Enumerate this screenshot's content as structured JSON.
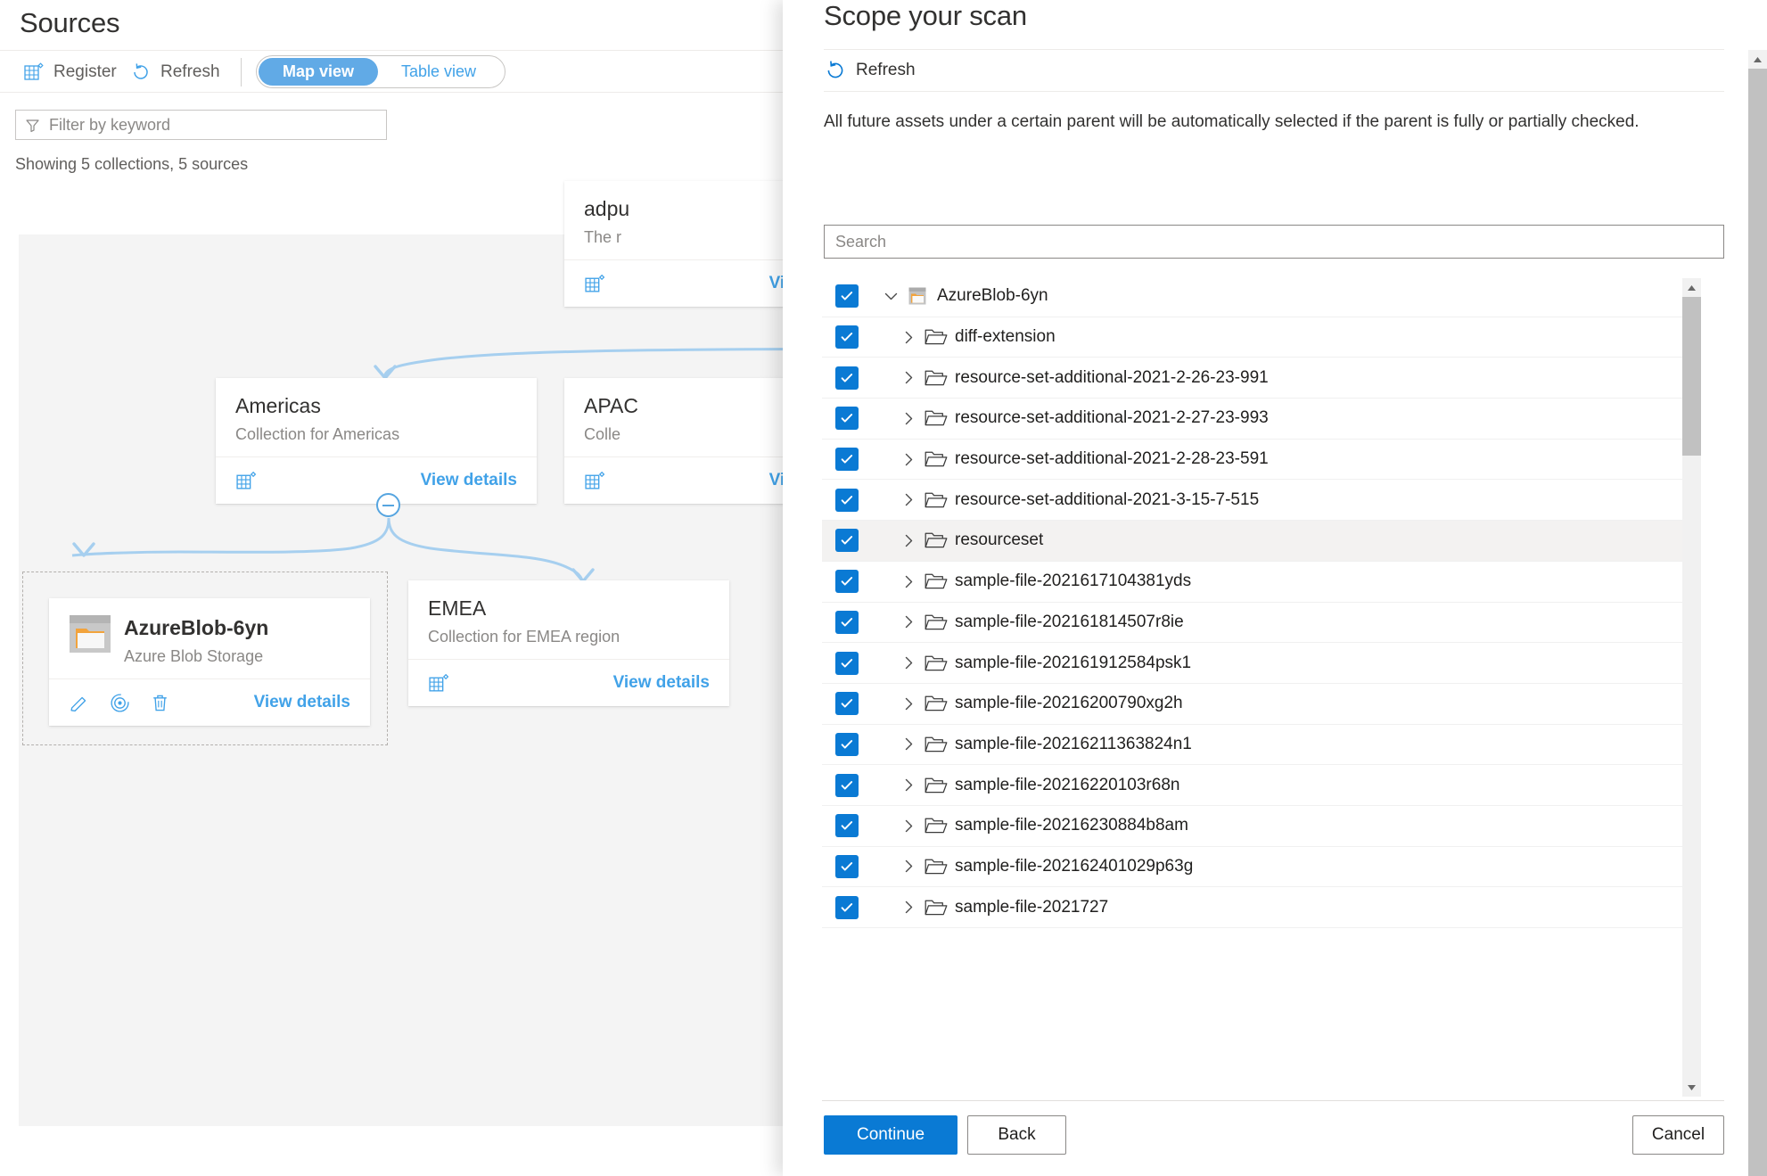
{
  "sources": {
    "title": "Sources",
    "commands": [
      {
        "label": "Register",
        "icon": "register-grid-icon"
      },
      {
        "label": "Refresh",
        "icon": "refresh-icon"
      }
    ],
    "view_toggle": {
      "active": "Map view",
      "inactive": "Table view"
    },
    "filter": {
      "placeholder": "Filter by keyword",
      "value": "",
      "icon": "filter-funnel-icon"
    },
    "status": "Showing 5 collections, 5 sources",
    "cards": [
      {
        "id": "adpurv",
        "title": "adpu",
        "subtitle": "The r",
        "footer_icon": "collection-grid-icon",
        "view_details": "View details",
        "clipped": true
      },
      {
        "id": "americas",
        "title": "Americas",
        "subtitle": "Collection for Americas",
        "footer_icon": "collection-grid-icon",
        "view_details": "View details",
        "clipped": false
      },
      {
        "id": "apac",
        "title": "APAC",
        "subtitle": "Colle",
        "footer_icon": "collection-grid-icon",
        "view_details": "View details",
        "clipped": true
      },
      {
        "id": "emea",
        "title": "EMEA",
        "subtitle": "Collection for EMEA region",
        "footer_icon": "collection-grid-icon",
        "view_details": "View details",
        "clipped": true
      }
    ],
    "source_card": {
      "title": "AzureBlob-6yn",
      "subtitle": "Azure Blob Storage",
      "icon": "azure-blob-storage-icon",
      "actions": [
        {
          "name": "edit-pencil-icon"
        },
        {
          "name": "scan-target-icon"
        },
        {
          "name": "delete-trash-icon"
        }
      ],
      "view_details": "View details"
    },
    "collapse_node": {
      "icon": "collapse-minus-icon"
    }
  },
  "scan_panel": {
    "title": "Scope your scan",
    "refresh": {
      "label": "Refresh",
      "icon": "refresh-icon"
    },
    "description": "All future assets under a certain parent will be automatically selected if the parent is fully or partially checked.",
    "search": {
      "placeholder": "Search",
      "value": ""
    },
    "tree": [
      {
        "label": "AzureBlob-6yn",
        "level": 0,
        "checked": true,
        "expanded": true,
        "icon": "storage-account-icon",
        "hover": false
      },
      {
        "label": "diff-extension",
        "level": 1,
        "checked": true,
        "expanded": false,
        "icon": "folder-icon",
        "hover": false
      },
      {
        "label": "resource-set-additional-2021-2-26-23-991",
        "level": 1,
        "checked": true,
        "expanded": false,
        "icon": "folder-icon",
        "hover": false
      },
      {
        "label": "resource-set-additional-2021-2-27-23-993",
        "level": 1,
        "checked": true,
        "expanded": false,
        "icon": "folder-icon",
        "hover": false
      },
      {
        "label": "resource-set-additional-2021-2-28-23-591",
        "level": 1,
        "checked": true,
        "expanded": false,
        "icon": "folder-icon",
        "hover": false
      },
      {
        "label": "resource-set-additional-2021-3-15-7-515",
        "level": 1,
        "checked": true,
        "expanded": false,
        "icon": "folder-icon",
        "hover": false
      },
      {
        "label": "resourceset",
        "level": 1,
        "checked": true,
        "expanded": false,
        "icon": "folder-icon",
        "hover": true
      },
      {
        "label": "sample-file-2021617104381yds",
        "level": 1,
        "checked": true,
        "expanded": false,
        "icon": "folder-icon",
        "hover": false
      },
      {
        "label": "sample-file-202161814507r8ie",
        "level": 1,
        "checked": true,
        "expanded": false,
        "icon": "folder-icon",
        "hover": false
      },
      {
        "label": "sample-file-202161912584psk1",
        "level": 1,
        "checked": true,
        "expanded": false,
        "icon": "folder-icon",
        "hover": false
      },
      {
        "label": "sample-file-20216200790xg2h",
        "level": 1,
        "checked": true,
        "expanded": false,
        "icon": "folder-icon",
        "hover": false
      },
      {
        "label": "sample-file-20216211363824n1",
        "level": 1,
        "checked": true,
        "expanded": false,
        "icon": "folder-icon",
        "hover": false
      },
      {
        "label": "sample-file-20216220103r68n",
        "level": 1,
        "checked": true,
        "expanded": false,
        "icon": "folder-icon",
        "hover": false
      },
      {
        "label": "sample-file-20216230884b8am",
        "level": 1,
        "checked": true,
        "expanded": false,
        "icon": "folder-icon",
        "hover": false
      },
      {
        "label": "sample-file-202162401029p63g",
        "level": 1,
        "checked": true,
        "expanded": false,
        "icon": "folder-icon",
        "hover": false
      },
      {
        "label": "sample-file-2021727",
        "level": 1,
        "checked": true,
        "expanded": false,
        "icon": "folder-icon",
        "hover": false
      }
    ],
    "buttons": {
      "continue": "Continue",
      "back": "Back",
      "cancel": "Cancel"
    }
  },
  "colors": {
    "accent_blue": "#0a7ad4",
    "link_blue": "#41a2e8",
    "toggle_blue": "#61aae6",
    "connector_blue": "#a6cfef",
    "canvas_gray": "#f4f4f4",
    "text_dark": "#323130",
    "text_muted": "#8a8886",
    "scrollbar_thumb": "#c1c1c1"
  }
}
